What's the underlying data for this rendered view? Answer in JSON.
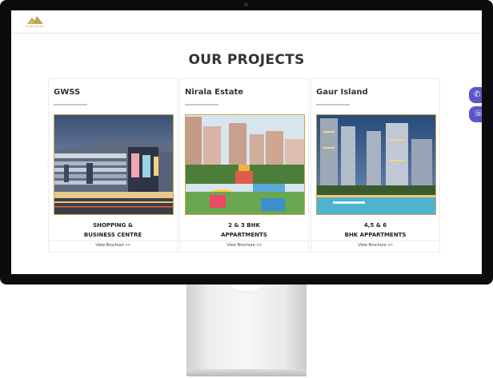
{
  "site": {
    "logo_text": "GAUR GROUP",
    "section_title": "OUR PROJECTS"
  },
  "projects": [
    {
      "title": "GWSS",
      "desc_line1": "SHOPPING &",
      "desc_line2": "BUSINESS CENTRE",
      "link": "View Brochure >>"
    },
    {
      "title": "Nirala Estate",
      "desc_line1": "2 & 3 BHK",
      "desc_line2": "APPARTMENTS",
      "link": "View Brochure >>"
    },
    {
      "title": "Gaur Island",
      "desc_line1": "4,5 & 6",
      "desc_line2": "BHK APPARTMENTS",
      "link": "View Brochure >>"
    }
  ],
  "carousel": {
    "prev": "‹",
    "next": "›"
  },
  "floating": {
    "whatsapp": "✆",
    "phone": "☏"
  },
  "colors": {
    "accent": "#5b57c9",
    "gold": "#c6a54e",
    "underline": "#c9c4cf"
  }
}
